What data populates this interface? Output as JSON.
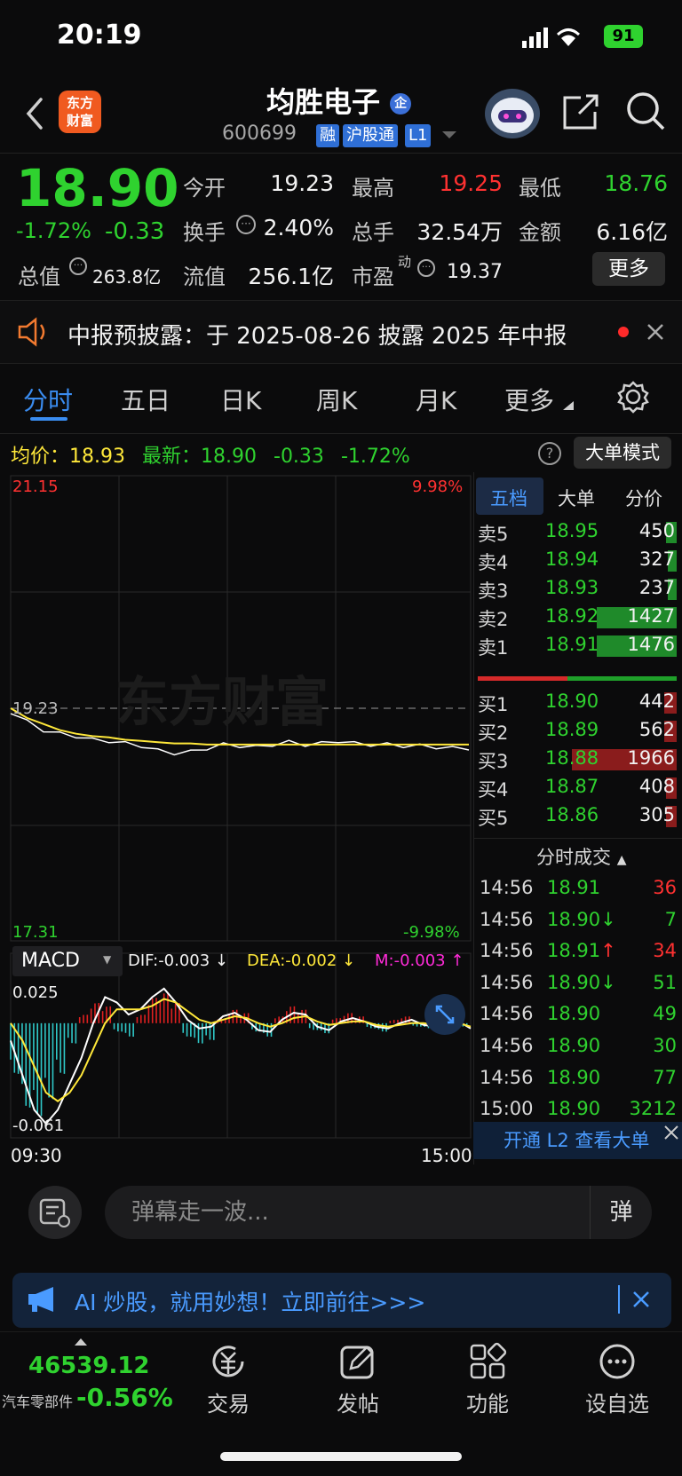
{
  "status_bar": {
    "time": "20:19",
    "battery": "91"
  },
  "header": {
    "logo_text": "东方\n财富",
    "stock_name": "均胜电子",
    "code": "600699",
    "tags": [
      "融",
      "沪股通",
      "L1"
    ]
  },
  "quote": {
    "price": "18.90",
    "change_pct": "-1.72%",
    "change": "-0.33",
    "fields": {
      "open_label": "今开",
      "open": "19.23",
      "high_label": "最高",
      "high": "19.25",
      "low_label": "最低",
      "low": "18.76",
      "turnover_label": "换手",
      "turnover": "2.40%",
      "volume_label": "总手",
      "volume": "32.54万",
      "amount_label": "金额",
      "amount": "6.16亿",
      "mktcap_label": "总值",
      "mktcap": "263.8亿",
      "float_label": "流值",
      "float": "256.1亿",
      "pe_label": "市盈",
      "pe_sup": "动",
      "pe": "19.37"
    },
    "more_label": "更多"
  },
  "notice": {
    "text": "中报预披露：于 2025-08-26 披露 2025 年中报"
  },
  "tabs": [
    "分时",
    "五日",
    "日K",
    "周K",
    "月K",
    "更多"
  ],
  "info_line": {
    "avg_label": "均价：",
    "avg": "18.93",
    "latest_label": "最新：",
    "latest": "18.90",
    "change": "-0.33",
    "change_pct": "-1.72%",
    "big_order_mode": "大单模式"
  },
  "chart_data": {
    "type": "line",
    "title": "",
    "y_high": "21.15",
    "y_high_pct": "9.98%",
    "y_low": "17.31",
    "y_low_pct": "-9.98%",
    "ref_price": "19.23",
    "watermark": "东方财富",
    "x_start": "09:30",
    "x_end": "15:00",
    "ylim": [
      17.31,
      21.15
    ],
    "series": [
      {
        "values": [
          19.2,
          19.12,
          19.05,
          19.02,
          19.0,
          18.97,
          18.96,
          18.94,
          18.92,
          18.88,
          18.86,
          18.87,
          18.9,
          18.93,
          18.92,
          18.91,
          18.93,
          18.95,
          18.93,
          18.94,
          18.96,
          18.94,
          18.93,
          18.93,
          18.92,
          18.92,
          18.91,
          18.9,
          18.9
        ]
      },
      {
        "values": [
          19.23,
          19.15,
          19.1,
          19.05,
          19.02,
          19.0,
          18.99,
          18.97,
          18.96,
          18.95,
          18.94,
          18.94,
          18.93,
          18.93,
          18.93,
          18.93,
          18.93,
          18.93,
          18.93,
          18.93,
          18.93,
          18.93,
          18.93,
          18.93,
          18.93,
          18.93,
          18.93,
          18.93,
          18.93
        ]
      }
    ]
  },
  "macd": {
    "label": "MACD",
    "dif": "DIF:-0.003 ↓",
    "dea": "DEA:-0.002 ↓",
    "m": "M:-0.003 ↑",
    "top": "0.025",
    "bottom": "-0.061",
    "hist": [
      -0.03,
      -0.05,
      -0.055,
      -0.045,
      -0.03,
      -0.012,
      0.005,
      0.012,
      0.01,
      -0.005,
      -0.008,
      0.005,
      0.015,
      0.018,
      0.012,
      -0.008,
      -0.012,
      -0.01,
      0.003,
      0.008,
      0.006,
      -0.005,
      -0.008,
      0.004,
      0.01,
      0.008,
      -0.004,
      -0.006,
      0.003,
      0.006,
      0.004,
      -0.003,
      -0.005,
      0.002,
      0.004,
      -0.002,
      -0.003,
      0.002,
      0.003,
      -0.002
    ],
    "dif_values": [
      -0.01,
      -0.03,
      -0.05,
      -0.058,
      -0.05,
      -0.035,
      -0.02,
      0.0,
      0.015,
      0.012,
      0.005,
      0.008,
      0.015,
      0.02,
      0.012,
      0.002,
      -0.003,
      -0.002,
      0.004,
      0.006,
      0.002,
      -0.004,
      -0.005,
      0.002,
      0.006,
      0.005,
      -0.002,
      -0.004,
      0.001,
      0.003,
      0.001,
      -0.002,
      -0.003,
      0.0,
      0.002,
      -0.001,
      -0.002,
      0.0,
      0.001,
      -0.003
    ],
    "dea_values": [
      0.0,
      -0.01,
      -0.025,
      -0.04,
      -0.045,
      -0.04,
      -0.03,
      -0.015,
      0.0,
      0.008,
      0.008,
      0.008,
      0.01,
      0.014,
      0.012,
      0.007,
      0.002,
      0.0,
      0.002,
      0.004,
      0.003,
      0.0,
      -0.002,
      0.0,
      0.003,
      0.004,
      0.001,
      -0.001,
      0.0,
      0.001,
      0.001,
      -0.001,
      -0.002,
      -0.001,
      0.0,
      0.0,
      -0.001,
      -0.001,
      0.0,
      -0.002
    ]
  },
  "order_book": {
    "tabs": [
      "五档",
      "大单",
      "分价"
    ],
    "asks": [
      {
        "label": "卖5",
        "price": "18.95",
        "vol": "450",
        "bar": 0.1
      },
      {
        "label": "卖4",
        "price": "18.94",
        "vol": "327",
        "bar": 0.08
      },
      {
        "label": "卖3",
        "price": "18.93",
        "vol": "237",
        "bar": 0.08
      },
      {
        "label": "卖2",
        "price": "18.92",
        "vol": "1427",
        "bar": 0.75
      },
      {
        "label": "卖1",
        "price": "18.91",
        "vol": "1476",
        "bar": 0.75
      }
    ],
    "bids": [
      {
        "label": "买1",
        "price": "18.90",
        "vol": "442",
        "bar": 0.12
      },
      {
        "label": "买2",
        "price": "18.89",
        "vol": "562",
        "bar": 0.12
      },
      {
        "label": "买3",
        "price": "18.88",
        "vol": "1966",
        "bar": 0.98
      },
      {
        "label": "买4",
        "price": "18.87",
        "vol": "408",
        "bar": 0.1
      },
      {
        "label": "买5",
        "price": "18.86",
        "vol": "305",
        "bar": 0.1
      }
    ],
    "ratio_bar": 0.45
  },
  "trades": {
    "title": "分时成交",
    "rows": [
      {
        "time": "14:56",
        "price": "18.91",
        "vol": "36",
        "dir": "red"
      },
      {
        "time": "14:56",
        "price": "18.90↓",
        "vol": "7",
        "dir": "green"
      },
      {
        "time": "14:56",
        "price": "18.91↑",
        "vol": "34",
        "dir": "red"
      },
      {
        "time": "14:56",
        "price": "18.90↓",
        "vol": "51",
        "dir": "green"
      },
      {
        "time": "14:56",
        "price": "18.90",
        "vol": "49",
        "dir": "green"
      },
      {
        "time": "14:56",
        "price": "18.90",
        "vol": "30",
        "dir": "green"
      },
      {
        "time": "14:56",
        "price": "18.90",
        "vol": "77",
        "dir": "green"
      },
      {
        "time": "15:00",
        "price": "18.90",
        "vol": "3212",
        "dir": "green"
      }
    ],
    "l2_label": "开通 L2 查看大单"
  },
  "bullet": {
    "placeholder": "弹幕走一波...",
    "send": "弹"
  },
  "ai_banner": {
    "text": "AI 炒股，就用妙想！立即前往>>>"
  },
  "bottom_nav": {
    "index_value": "46539.12",
    "index_name": "汽车零部件",
    "index_change": "-0.56%",
    "items": [
      "交易",
      "发帖",
      "功能",
      "设自选"
    ]
  }
}
